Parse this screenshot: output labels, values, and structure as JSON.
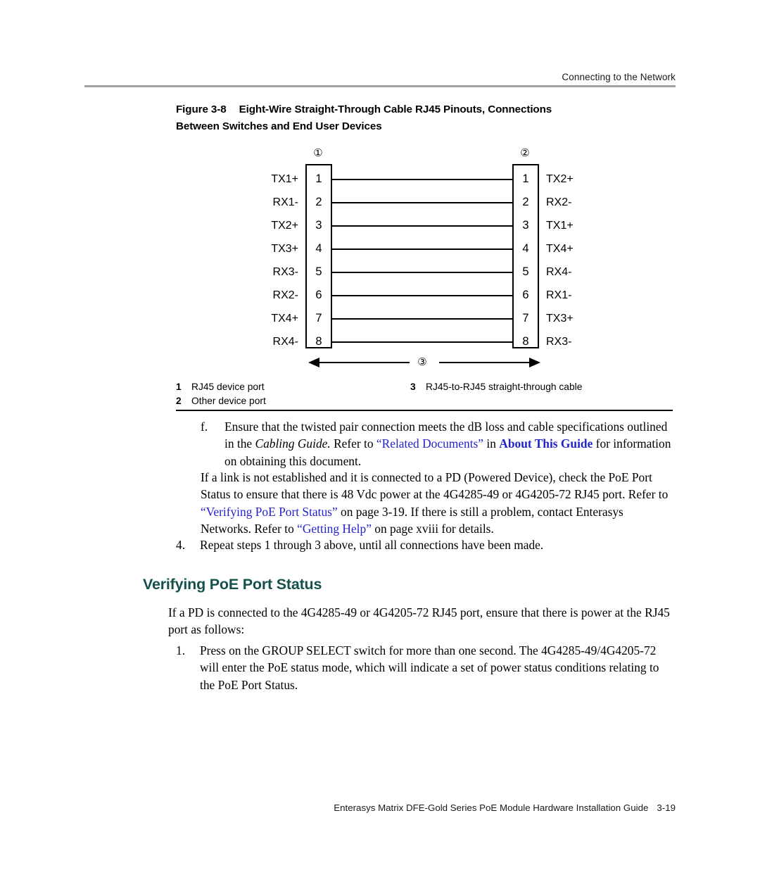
{
  "header": {
    "running_head": "Connecting to the Network"
  },
  "figure": {
    "number": "Figure 3-8",
    "title_line1": "Eight-Wire Straight-Through Cable RJ45 Pinouts, Connections",
    "title_line2": "Between Switches and End User Devices",
    "callout_left": "①",
    "callout_right": "②",
    "callout_cable": "③",
    "pins": [
      {
        "num": "1",
        "left_signal": "TX1+",
        "right_signal": "TX2+"
      },
      {
        "num": "2",
        "left_signal": "RX1-",
        "right_signal": "RX2-"
      },
      {
        "num": "3",
        "left_signal": "TX2+",
        "right_signal": "TX1+"
      },
      {
        "num": "4",
        "left_signal": "TX3+",
        "right_signal": "TX4+"
      },
      {
        "num": "5",
        "left_signal": "RX3-",
        "right_signal": "RX4-"
      },
      {
        "num": "6",
        "left_signal": "RX2-",
        "right_signal": "RX1-"
      },
      {
        "num": "7",
        "left_signal": "TX4+",
        "right_signal": "TX3+"
      },
      {
        "num": "8",
        "left_signal": "RX4-",
        "right_signal": "RX3-"
      }
    ],
    "legend": {
      "column1": [
        {
          "key": "1",
          "text": "RJ45 device port"
        },
        {
          "key": "2",
          "text": "Other device port"
        }
      ],
      "column2": [
        {
          "key": "3",
          "text": "RJ45-to-RJ45 straight-through cable"
        }
      ]
    }
  },
  "body": {
    "item_f": {
      "marker": "f.",
      "text_part1": "Ensure that the twisted pair connection meets the dB loss and cable specifications outlined in the ",
      "italic_title": "Cabling Guide.",
      "text_part2": " Refer to ",
      "link1": "“Related Documents”",
      "text_part3": " in ",
      "link2": "About This Guide",
      "text_part4": " for information on obtaining this document."
    },
    "paragraph_pd": {
      "text_part1": "If a link is not established and it is connected to a PD (Powered Device), check the PoE Port Status to ensure that there is 48 Vdc power at the 4G4285-49 or 4G4205-72 RJ45 port. Refer to ",
      "link1": "“Verifying PoE Port Status”",
      "text_part2": " on page 3-19. If there is still a problem, contact Enterasys Networks. Refer to ",
      "link2": "“Getting Help”",
      "text_part3": "  on page xviii for details."
    },
    "step4": {
      "marker": "4.",
      "text": "Repeat steps 1 through 3 above, until all connections have been made."
    },
    "section_heading": "Verifying PoE Port Status",
    "paragraph_intro": "If a PD is connected to the 4G4285-49 or 4G4205-72 RJ45 port, ensure that there is power at the RJ45 port as follows:",
    "step1": {
      "marker": "1.",
      "text": "Press on the GROUP SELECT switch for more than one second. The 4G4285-49/4G4205-72 will enter the PoE status mode, which will indicate a set of power status conditions relating to the PoE Port Status."
    }
  },
  "footer": {
    "guide_title": "Enterasys Matrix DFE-Gold Series PoE Module Hardware Installation Guide",
    "page_number": "3-19"
  },
  "colors": {
    "link": "#2323cc",
    "heading": "#14504c",
    "header_rule": "#a3a3a3"
  }
}
